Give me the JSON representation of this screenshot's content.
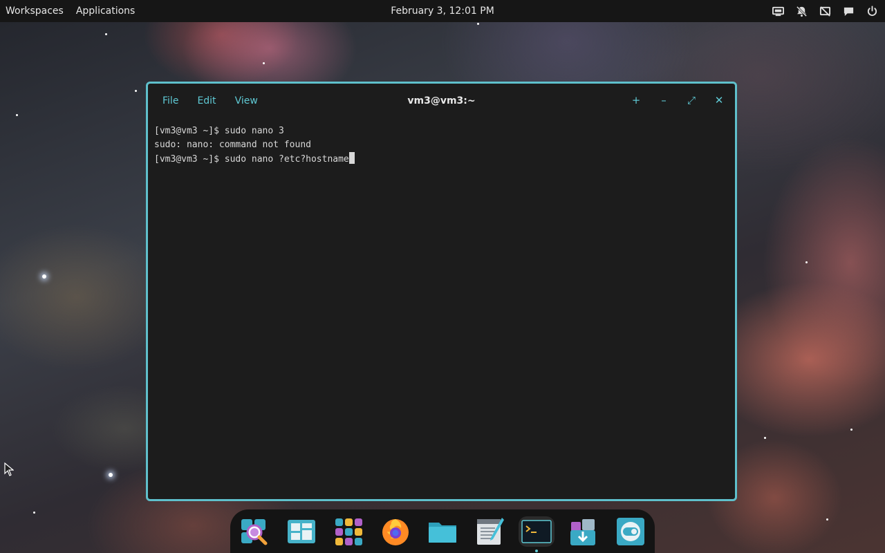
{
  "top_panel": {
    "workspaces_label": "Workspaces",
    "applications_label": "Applications",
    "clock": "February 3, 12:01 PM"
  },
  "terminal": {
    "title": "vm3@vm3:~",
    "menu": [
      "File",
      "Edit",
      "View"
    ],
    "lines": [
      "[vm3@vm3 ~]$ sudo nano 3",
      "sudo: nano: command not found",
      "[vm3@vm3 ~]$ sudo nano ?etc?hostname"
    ],
    "controls": [
      "+",
      "–",
      "⤢",
      "✕"
    ]
  },
  "dock": {
    "items": [
      "search-app",
      "multitasking-view",
      "app-grid",
      "firefox",
      "files",
      "text-editor",
      "terminal",
      "software-installer",
      "settings-toggle"
    ],
    "active_item": "terminal"
  },
  "colors": {
    "accent": "#5fc9d4",
    "panel_bg": "#161616",
    "terminal_bg": "#1c1c1c"
  }
}
